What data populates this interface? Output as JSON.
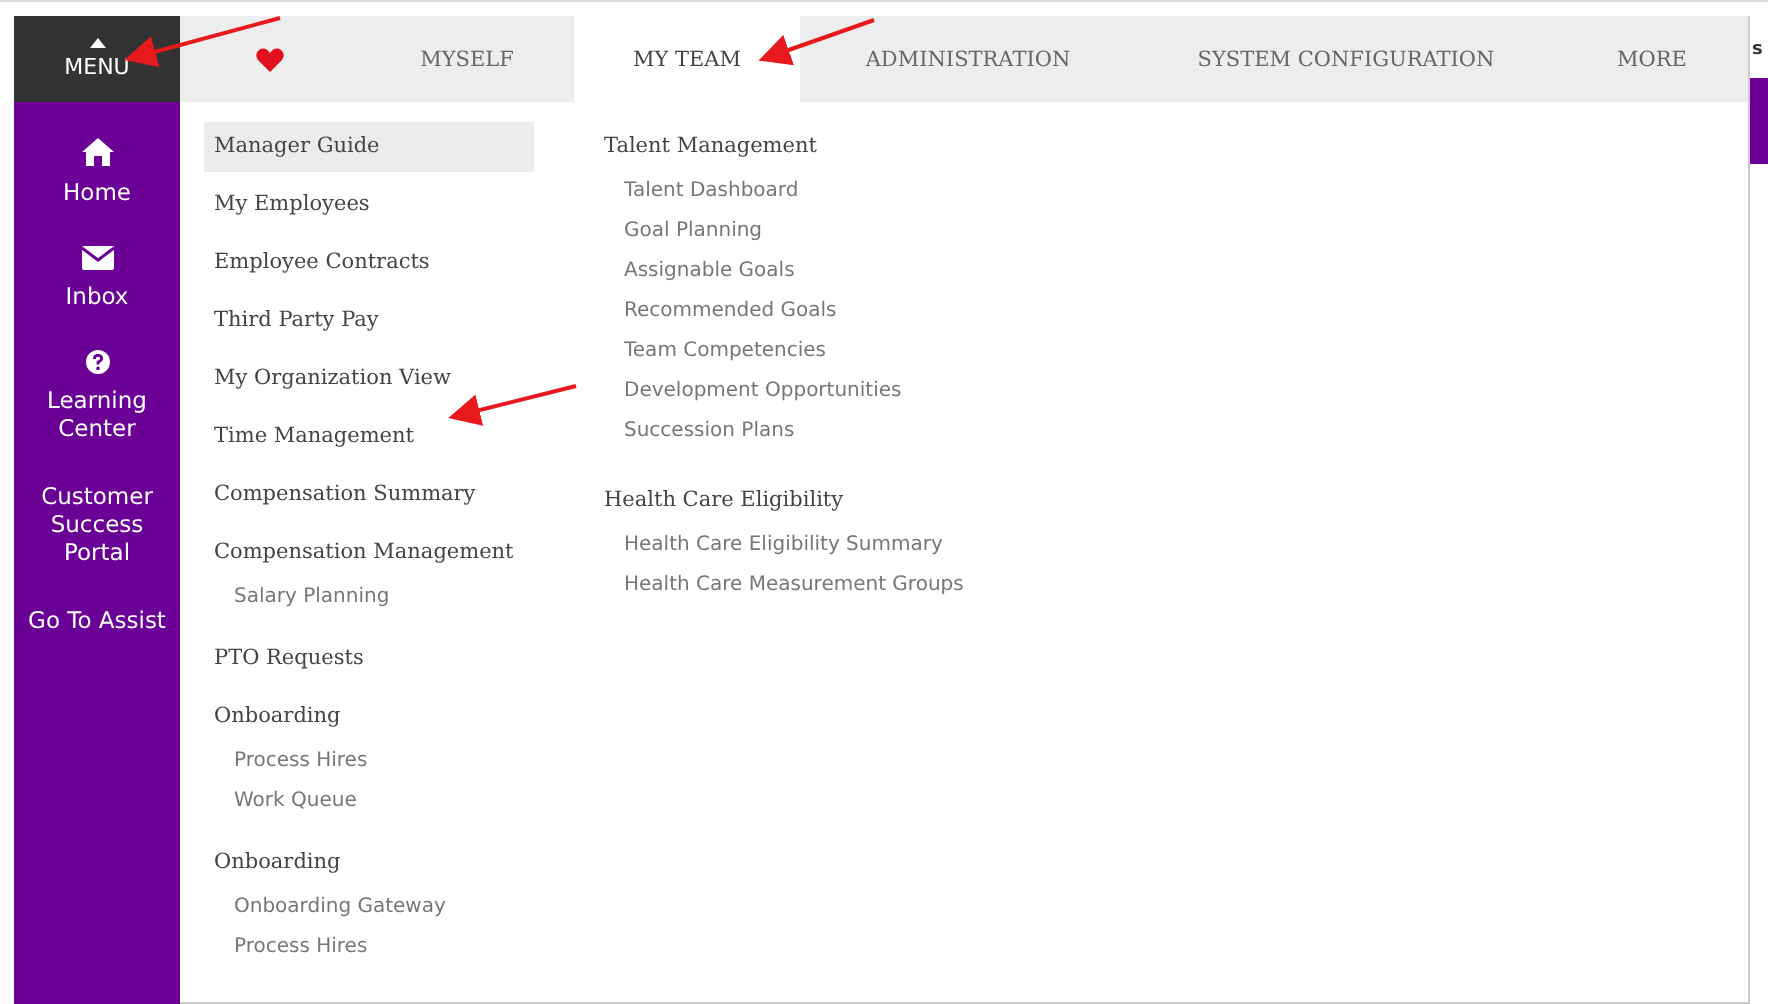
{
  "sidebar": {
    "menu_label": "MENU",
    "items": [
      {
        "label": "Home",
        "kind": "home"
      },
      {
        "label": "Inbox",
        "kind": "mail"
      },
      {
        "label": "Learning Center",
        "kind": "help"
      },
      {
        "label": "Customer Success Portal",
        "kind": "plain"
      },
      {
        "label": "Go To Assist",
        "kind": "plain"
      }
    ]
  },
  "nav_tabs": [
    {
      "kind": "heart",
      "selected": false
    },
    {
      "kind": "text",
      "label": "MYSELF",
      "selected": false
    },
    {
      "kind": "text",
      "label": "MY TEAM",
      "selected": true
    },
    {
      "kind": "text",
      "label": "ADMINISTRATION",
      "selected": false
    },
    {
      "kind": "text",
      "label": "SYSTEM CONFIGURATION",
      "selected": false
    },
    {
      "kind": "text",
      "label": "MORE",
      "selected": false
    }
  ],
  "menu_columns": [
    [
      {
        "label": "Manager Guide",
        "selected": true
      },
      {
        "label": "My Employees",
        "selected": false
      },
      {
        "label": "Employee Contracts",
        "selected": false
      },
      {
        "label": "Third Party Pay",
        "selected": false
      },
      {
        "label": "My Organization View",
        "selected": false
      },
      {
        "label": "Time Management",
        "selected": false
      },
      {
        "label": "Compensation Summary",
        "selected": false
      },
      {
        "label": "Compensation Management",
        "selected": false,
        "children": [
          "Salary Planning"
        ]
      },
      {
        "label": "PTO Requests",
        "selected": false
      },
      {
        "label": "Onboarding",
        "selected": false,
        "children": [
          "Process Hires",
          "Work Queue"
        ]
      },
      {
        "label": "Onboarding",
        "selected": false,
        "children": [
          "Onboarding Gateway",
          "Process Hires"
        ]
      }
    ],
    [
      {
        "label": "Talent Management",
        "selected": false,
        "children": [
          "Talent Dashboard",
          "Goal Planning",
          "Assignable Goals",
          "Recommended Goals",
          "Team Competencies",
          "Development Opportunities",
          "Succession Plans"
        ]
      },
      {
        "label": "Health Care Eligibility",
        "selected": false,
        "children": [
          "Health Care Eligibility Summary",
          "Health Care Measurement Groups"
        ]
      }
    ]
  ],
  "background_page": {
    "text": "s"
  }
}
